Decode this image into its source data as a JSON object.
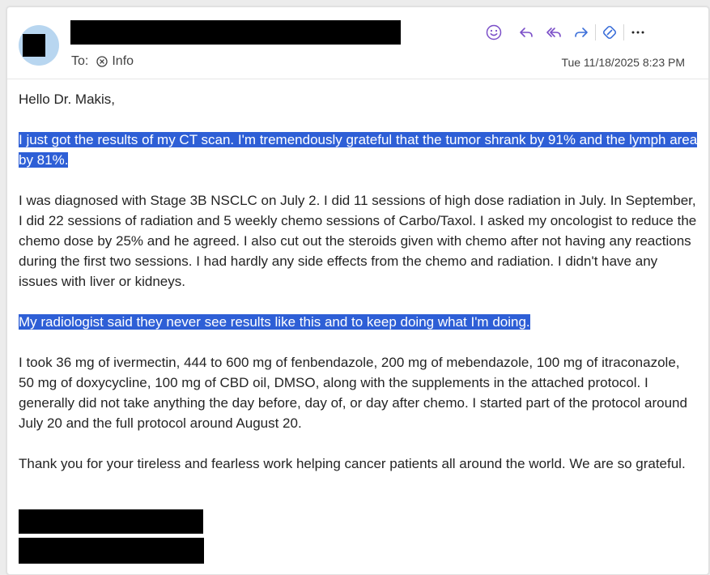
{
  "header": {
    "to_label": "To:",
    "recipient": "Info",
    "date": "Tue 11/18/2025 8:23 PM"
  },
  "toolbar": {
    "icons": [
      "emoji-icon",
      "reply-icon",
      "reply-all-icon",
      "forward-icon",
      "loop-icon",
      "more-icon"
    ],
    "accent_color": "#7b4fc8"
  },
  "colors": {
    "highlight": "#2e5fd6",
    "avatar_bg": "#b8d6f0"
  },
  "body": {
    "greeting": "Hello Dr. Makis,",
    "p1": "I just got the results of my CT scan. I'm tremendously grateful that the tumor shrank by 91% and the lymph area by 81%.",
    "p2": "I was diagnosed with Stage 3B NSCLC on July 2. I did 11 sessions of high dose radiation in July. In September, I did 22 sessions of radiation and 5 weekly chemo sessions of Carbo/Taxol. I asked my oncologist to reduce the chemo dose by 25% and he agreed. I also cut out the steroids given with chemo after not having any reactions during the first two sessions. I had hardly any side effects from the chemo and radiation. I didn't have any issues with liver or kidneys.",
    "p3": "My radiologist said they never see results like this and to keep doing what I'm doing.",
    "p4": "I took 36 mg of ivermectin, 444 to 600 mg of fenbendazole, 200 mg of mebendazole, 100 mg of itraconazole, 50 mg of doxycycline, 100 mg of CBD oil, DMSO, along with the supplements in the attached protocol. I generally did not take anything the day before, day of, or day after chemo. I started part of the protocol around July 20 and the full protocol around August 20.",
    "p5": "Thank you for your tireless and fearless work helping cancer patients all around the world. We are so grateful."
  }
}
